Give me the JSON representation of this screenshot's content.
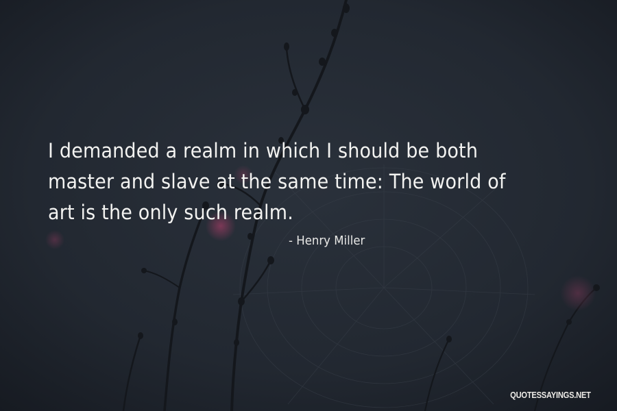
{
  "quote": {
    "lines": [
      "I demanded a realm in which I should be both",
      "master and slave at the same time: The world of",
      "art is the only such realm."
    ],
    "author": "- Henry Miller"
  },
  "watermark": "QUOTESSAYINGS.NET",
  "colors": {
    "background": "#212730",
    "text": "#f3f3f1",
    "blossom": "#7a3a55"
  }
}
